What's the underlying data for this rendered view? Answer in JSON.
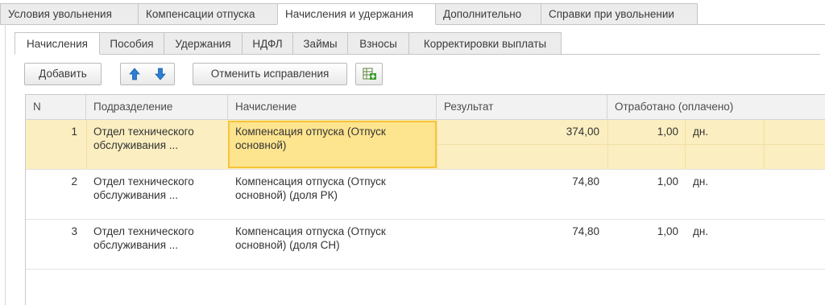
{
  "top_tabs": [
    {
      "label": "Условия увольнения",
      "active": false
    },
    {
      "label": "Компенсации отпуска",
      "active": false
    },
    {
      "label": "Начисления и удержания",
      "active": true
    },
    {
      "label": "Дополнительно",
      "active": false
    },
    {
      "label": "Справки при увольнении",
      "active": false
    }
  ],
  "sub_tabs": [
    {
      "label": "Начисления",
      "active": true
    },
    {
      "label": "Пособия",
      "active": false
    },
    {
      "label": "Удержания",
      "active": false
    },
    {
      "label": "НДФЛ",
      "active": false
    },
    {
      "label": "Займы",
      "active": false
    },
    {
      "label": "Взносы",
      "active": false
    },
    {
      "label": "Корректировки выплаты",
      "active": false
    }
  ],
  "toolbar": {
    "add_label": "Добавить",
    "up_icon": "arrow-up-icon",
    "down_icon": "arrow-down-icon",
    "cancel_corrections_label": "Отменить исправления",
    "table_add_icon": "table-add-icon",
    "accent_color": "#2b7ed6"
  },
  "table": {
    "headers": {
      "n": "N",
      "department": "Подразделение",
      "accrual": "Начисление",
      "result": "Результат",
      "worked": "Отработано (оплачено)"
    },
    "rows": [
      {
        "n": "1",
        "department_line1": "Отдел технического",
        "department_line2": "обслуживания ...",
        "accrual_line1": "Компенсация отпуска (Отпуск",
        "accrual_line2": "основной)",
        "result": "374,00",
        "worked": "1,00",
        "unit": "дн.",
        "selected": true
      },
      {
        "n": "2",
        "department_line1": "Отдел технического",
        "department_line2": "обслуживания ...",
        "accrual_line1": "Компенсация отпуска (Отпуск",
        "accrual_line2": "основной) (доля РК)",
        "result": "74,80",
        "worked": "1,00",
        "unit": "дн.",
        "selected": false
      },
      {
        "n": "3",
        "department_line1": "Отдел технического",
        "department_line2": "обслуживания ...",
        "accrual_line1": "Компенсация отпуска (Отпуск",
        "accrual_line2": "основной) (доля СН)",
        "result": "74,80",
        "worked": "1,00",
        "unit": "дн.",
        "selected": false
      }
    ],
    "selected_row_color": "#fbeec0",
    "focused_cell_color": "#fde48e"
  }
}
